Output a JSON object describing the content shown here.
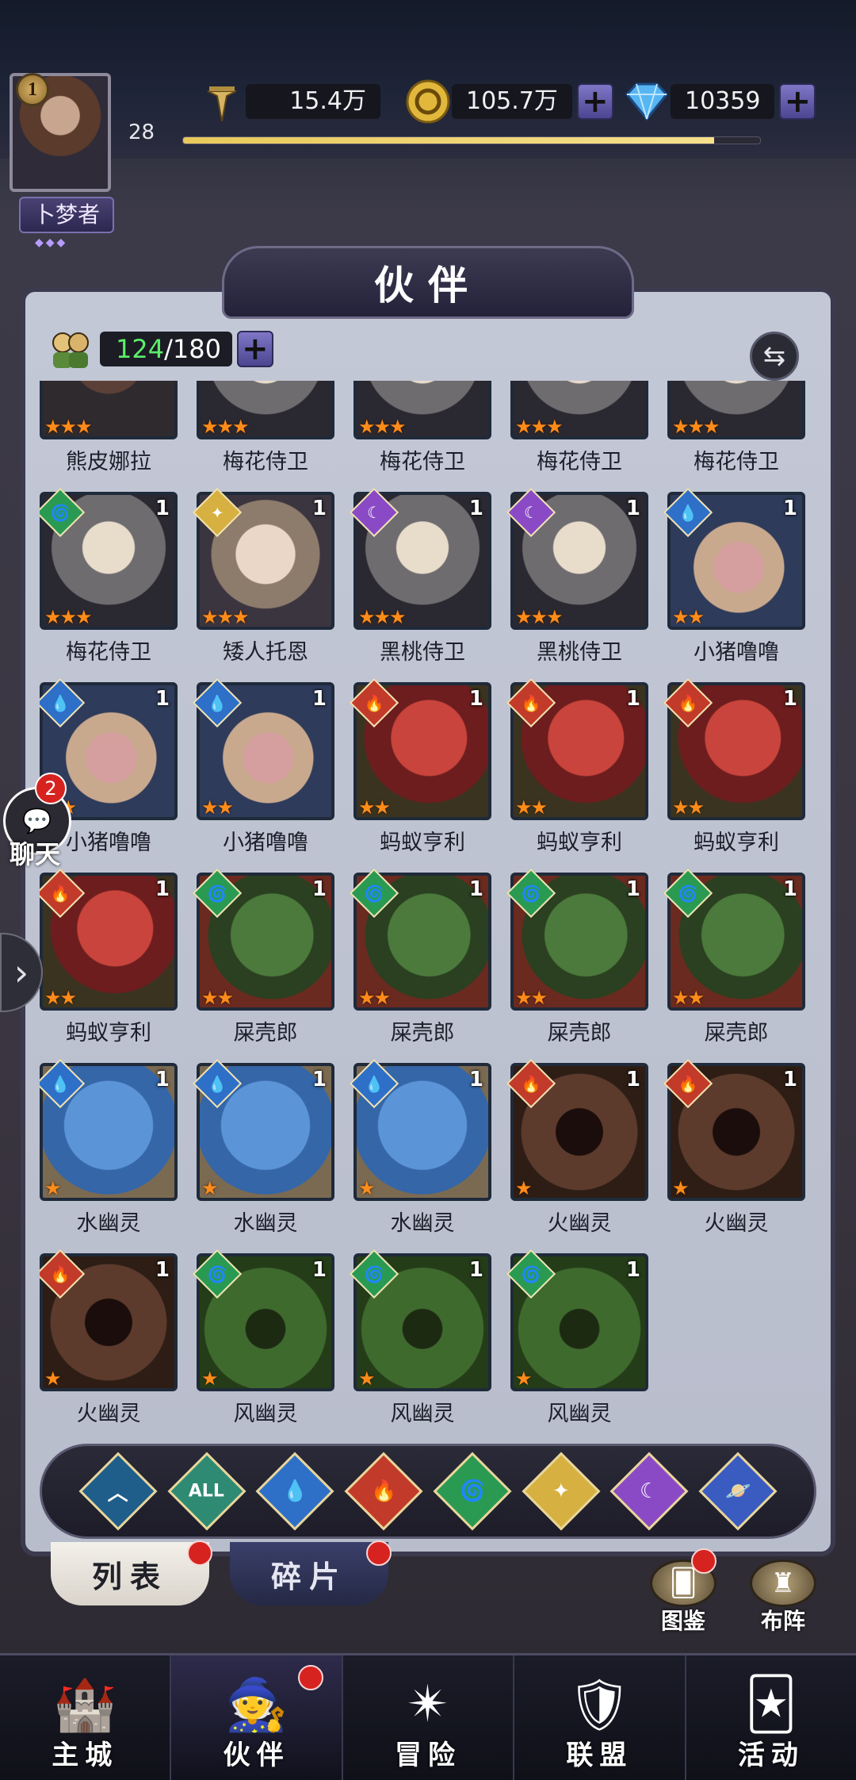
{
  "player": {
    "avatar_level": "1",
    "title": "卜梦者",
    "level": "28",
    "xp_fraction": 0.92
  },
  "resources": {
    "power": "15.4万",
    "gold": "105.7万",
    "diamonds": "10359"
  },
  "page": {
    "title": "伙伴"
  },
  "roster": {
    "owned": "124",
    "capacity": "/180"
  },
  "heroes": [
    {
      "name": "熊皮娜拉",
      "element": "",
      "portrait": "bear",
      "stars": "★★★",
      "level": ""
    },
    {
      "name": "梅花侍卫",
      "element": "",
      "portrait": "knight",
      "stars": "★★★",
      "level": ""
    },
    {
      "name": "梅花侍卫",
      "element": "",
      "portrait": "knight",
      "stars": "★★★",
      "level": ""
    },
    {
      "name": "梅花侍卫",
      "element": "",
      "portrait": "knight",
      "stars": "★★★",
      "level": ""
    },
    {
      "name": "梅花侍卫",
      "element": "",
      "portrait": "knight",
      "stars": "★★★",
      "level": ""
    },
    {
      "name": "梅花侍卫",
      "element": "wind",
      "portrait": "knight",
      "stars": "★★★",
      "level": "1"
    },
    {
      "name": "矮人托恩",
      "element": "light",
      "portrait": "dwarf",
      "stars": "★★★",
      "level": "1"
    },
    {
      "name": "黑桃侍卫",
      "element": "dark",
      "portrait": "knight",
      "stars": "★★★",
      "level": "1"
    },
    {
      "name": "黑桃侍卫",
      "element": "dark",
      "portrait": "knight",
      "stars": "★★★",
      "level": "1"
    },
    {
      "name": "小猪噜噜",
      "element": "water",
      "portrait": "pig",
      "stars": "★★",
      "level": "1"
    },
    {
      "name": "小猪噜噜",
      "element": "water",
      "portrait": "pig",
      "stars": "★★",
      "level": "1"
    },
    {
      "name": "小猪噜噜",
      "element": "water",
      "portrait": "pig",
      "stars": "★★",
      "level": "1"
    },
    {
      "name": "蚂蚁亨利",
      "element": "fire",
      "portrait": "fire",
      "stars": "★★",
      "level": "1"
    },
    {
      "name": "蚂蚁亨利",
      "element": "fire",
      "portrait": "fire",
      "stars": "★★",
      "level": "1"
    },
    {
      "name": "蚂蚁亨利",
      "element": "fire",
      "portrait": "fire",
      "stars": "★★",
      "level": "1"
    },
    {
      "name": "蚂蚁亨利",
      "element": "fire",
      "portrait": "fire",
      "stars": "★★",
      "level": "1"
    },
    {
      "name": "屎壳郎",
      "element": "wind",
      "portrait": "wind",
      "stars": "★★",
      "level": "1"
    },
    {
      "name": "屎壳郎",
      "element": "wind",
      "portrait": "wind",
      "stars": "★★",
      "level": "1"
    },
    {
      "name": "屎壳郎",
      "element": "wind",
      "portrait": "wind",
      "stars": "★★",
      "level": "1"
    },
    {
      "name": "屎壳郎",
      "element": "wind",
      "portrait": "wind",
      "stars": "★★",
      "level": "1"
    },
    {
      "name": "水幽灵",
      "element": "water",
      "portrait": "water",
      "stars": "★",
      "level": "1"
    },
    {
      "name": "水幽灵",
      "element": "water",
      "portrait": "water",
      "stars": "★",
      "level": "1"
    },
    {
      "name": "水幽灵",
      "element": "water",
      "portrait": "water",
      "stars": "★",
      "level": "1"
    },
    {
      "name": "火幽灵",
      "element": "fire",
      "portrait": "ghostfire",
      "stars": "★",
      "level": "1"
    },
    {
      "name": "火幽灵",
      "element": "fire",
      "portrait": "ghostfire",
      "stars": "★",
      "level": "1"
    },
    {
      "name": "火幽灵",
      "element": "fire",
      "portrait": "ghostfire",
      "stars": "★",
      "level": "1"
    },
    {
      "name": "风幽灵",
      "element": "wind",
      "portrait": "ghostwind",
      "stars": "★",
      "level": "1"
    },
    {
      "name": "风幽灵",
      "element": "wind",
      "portrait": "ghostwind",
      "stars": "★",
      "level": "1"
    },
    {
      "name": "风幽灵",
      "element": "wind",
      "portrait": "ghostwind",
      "stars": "★",
      "level": "1"
    }
  ],
  "element_glyphs": {
    "fire": "🔥",
    "wind": "🌀",
    "water": "💧",
    "dark": "☾",
    "light": "✦"
  },
  "chat": {
    "badge": "2",
    "label": "聊天"
  },
  "filters": [
    {
      "key": "up",
      "glyph": "︿"
    },
    {
      "key": "all",
      "glyph": "ALL"
    },
    {
      "key": "water",
      "glyph": "💧"
    },
    {
      "key": "fire",
      "glyph": "🔥"
    },
    {
      "key": "wind",
      "glyph": "🌀"
    },
    {
      "key": "light",
      "glyph": "✦"
    },
    {
      "key": "dark",
      "glyph": "☾"
    },
    {
      "key": "planet",
      "glyph": "🪐"
    }
  ],
  "tabs": {
    "list": "列表",
    "shards": "碎片"
  },
  "side_buttons": {
    "codex": "图鉴",
    "formation": "布阵"
  },
  "nav": [
    {
      "label": "主城",
      "icon": "castle-icon",
      "glyph": "🏰",
      "active": false,
      "dot": false
    },
    {
      "label": "伙伴",
      "icon": "wizard-hat-icon",
      "glyph": "🧙",
      "active": true,
      "dot": true
    },
    {
      "label": "冒险",
      "icon": "compass-icon",
      "glyph": "✴",
      "active": false,
      "dot": false
    },
    {
      "label": "联盟",
      "icon": "shield-icon",
      "glyph": "🛡",
      "active": false,
      "dot": false
    },
    {
      "label": "活动",
      "icon": "cards-icon",
      "glyph": "🃏",
      "active": false,
      "dot": false
    }
  ],
  "colors": {
    "accent_purple": "#5a52a6",
    "count_green": "#5cee6a",
    "notify_red": "#d7231f"
  }
}
